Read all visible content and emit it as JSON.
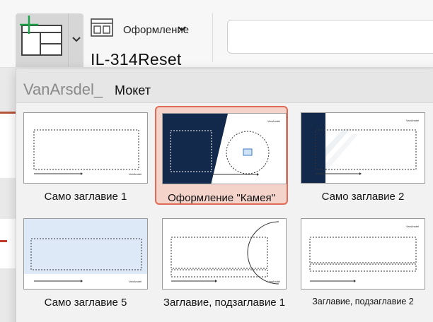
{
  "ribbon": {
    "layout_label": "Оформление",
    "reset_label": "IL-314Reset"
  },
  "gallery": {
    "brand": "VanArsdel_",
    "title": "Мокет",
    "thumb_brand": "VanArsdel",
    "layouts": [
      {
        "label": "Само заглавие 1"
      },
      {
        "label": "Оформление \"Камея\"",
        "selected": true
      },
      {
        "label": "Само заглавие 2"
      },
      {
        "label": "Само заглавие 5"
      },
      {
        "label": "Заглавие, подзаглавие 1"
      },
      {
        "label": "Заглавие, подзаглавие 2"
      }
    ]
  },
  "colors": {
    "accent": "#e06a53",
    "navy": "#13294b",
    "selected_bg": "#f4d3ca",
    "new_slide_green": "#1fa34a"
  },
  "icons": {
    "new_slide": "new-slide-icon",
    "layout": "layout-icon",
    "chevron": "chevron-down-icon"
  }
}
